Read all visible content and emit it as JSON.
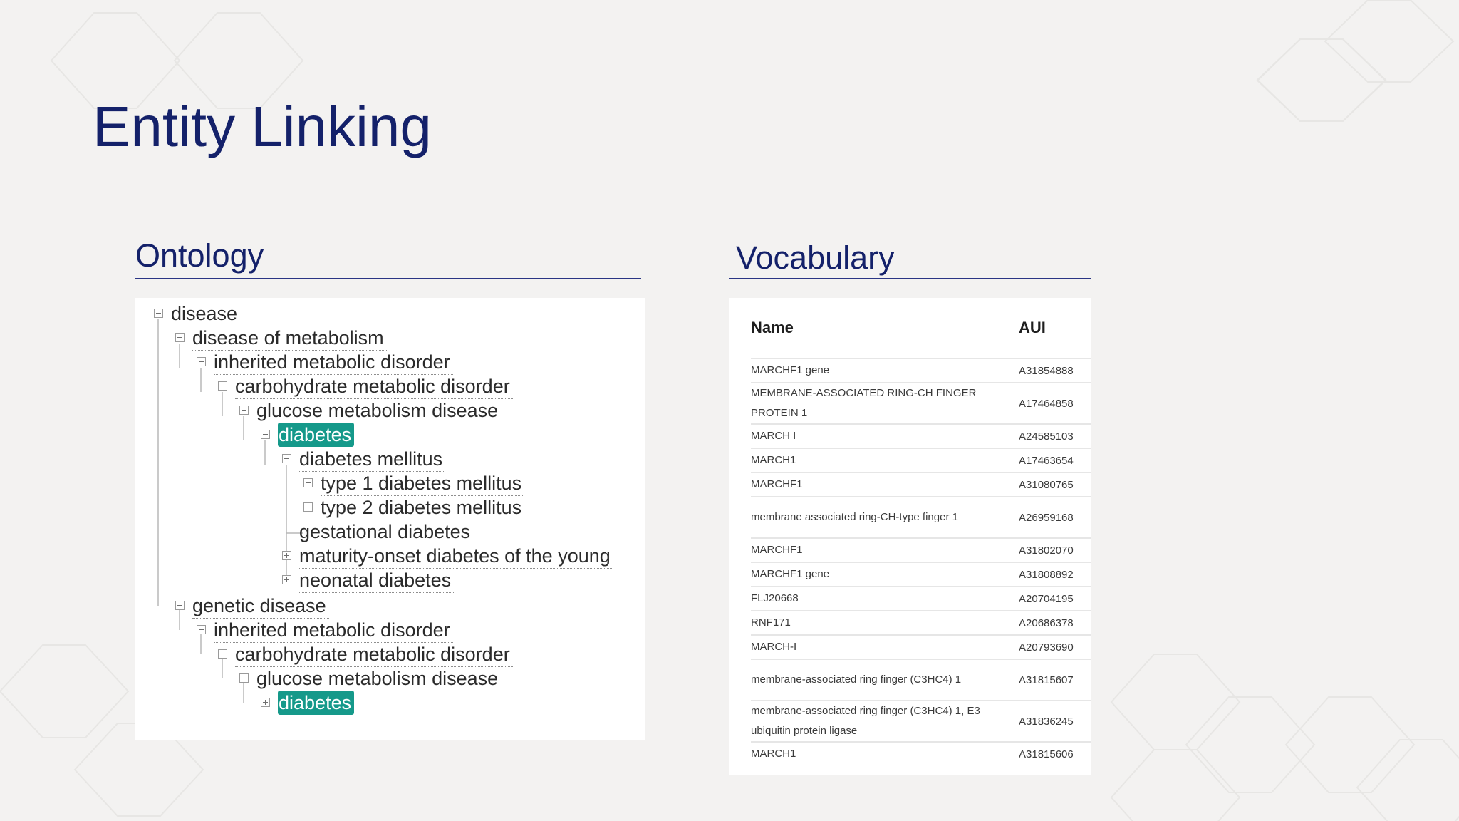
{
  "slide": {
    "title": "Entity Linking"
  },
  "ontology": {
    "heading": "Ontology",
    "nodes": [
      {
        "label": "disease",
        "toggle": "minus",
        "highlight": false
      },
      {
        "label": "disease of metabolism",
        "toggle": "minus",
        "highlight": false
      },
      {
        "label": "inherited metabolic disorder",
        "toggle": "minus",
        "highlight": false
      },
      {
        "label": "carbohydrate metabolic disorder",
        "toggle": "minus",
        "highlight": false
      },
      {
        "label": "glucose metabolism disease",
        "toggle": "minus",
        "highlight": false
      },
      {
        "label": "diabetes",
        "toggle": "minus",
        "highlight": true
      },
      {
        "label": "diabetes mellitus",
        "toggle": "minus",
        "highlight": false
      },
      {
        "label": "type 1 diabetes mellitus",
        "toggle": "plus",
        "highlight": false
      },
      {
        "label": "type 2 diabetes mellitus",
        "toggle": "plus",
        "highlight": false
      },
      {
        "label": "gestational diabetes",
        "toggle": "none",
        "highlight": false
      },
      {
        "label": "maturity-onset diabetes of the young",
        "toggle": "plus",
        "highlight": false
      },
      {
        "label": "neonatal diabetes",
        "toggle": "plus",
        "highlight": false
      },
      {
        "label": "genetic disease",
        "toggle": "minus",
        "highlight": false
      },
      {
        "label": "inherited metabolic disorder",
        "toggle": "minus",
        "highlight": false
      },
      {
        "label": "carbohydrate metabolic disorder",
        "toggle": "minus",
        "highlight": false
      },
      {
        "label": "glucose metabolism disease",
        "toggle": "minus",
        "highlight": false
      },
      {
        "label": "diabetes",
        "toggle": "plus",
        "highlight": true
      }
    ],
    "highlight_color": "#15998a"
  },
  "vocabulary": {
    "heading": "Vocabulary",
    "columns": {
      "name": "Name",
      "aui": "AUI"
    },
    "rows": [
      {
        "name": "MARCHF1 gene",
        "aui": "A31854888"
      },
      {
        "name": "MEMBRANE-ASSOCIATED RING-CH FINGER PROTEIN 1",
        "aui": "A17464858"
      },
      {
        "name": "MARCH I",
        "aui": "A24585103"
      },
      {
        "name": "MARCH1",
        "aui": "A17463654"
      },
      {
        "name": "MARCHF1",
        "aui": "A31080765"
      },
      {
        "name": "membrane associated ring-CH-type finger 1",
        "aui": "A26959168"
      },
      {
        "name": "MARCHF1",
        "aui": "A31802070"
      },
      {
        "name": "MARCHF1 gene",
        "aui": "A31808892"
      },
      {
        "name": "FLJ20668",
        "aui": "A20704195"
      },
      {
        "name": "RNF171",
        "aui": "A20686378"
      },
      {
        "name": "MARCH-I",
        "aui": "A20793690"
      },
      {
        "name": "membrane-associated ring finger (C3HC4) 1",
        "aui": "A31815607"
      },
      {
        "name": "membrane-associated ring finger (C3HC4) 1, E3 ubiquitin protein ligase",
        "aui": "A31836245"
      },
      {
        "name": "MARCH1",
        "aui": "A31815606"
      }
    ]
  },
  "theme": {
    "title_color": "#14216a",
    "background": "#f3f2f1"
  }
}
